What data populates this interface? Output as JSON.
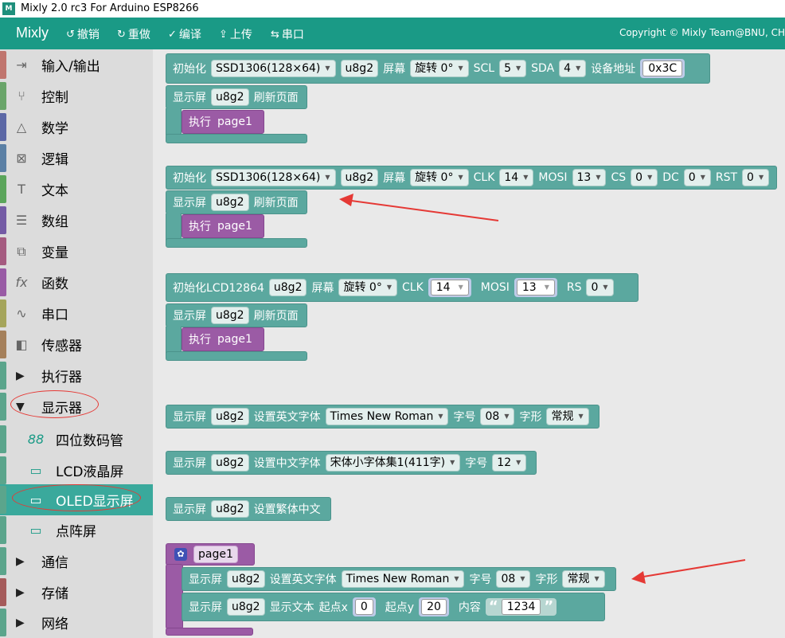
{
  "window": {
    "title": "Mixly 2.0 rc3 For Arduino ESP8266",
    "icon": "mixly-app-icon"
  },
  "toolbar": {
    "brand": "Mixly",
    "undo": "撤销",
    "redo": "重做",
    "compile": "编译",
    "upload": "上传",
    "serial": "串口",
    "copyright": "Copyright © Mixly Team@BNU, CH"
  },
  "sidebar": {
    "items": [
      {
        "label": "输入/输出",
        "icon": "login-icon",
        "color": "#c0756e"
      },
      {
        "label": "控制",
        "icon": "branch-icon",
        "color": "#6aa56a"
      },
      {
        "label": "数学",
        "icon": "compass-icon",
        "color": "#5c68a6"
      },
      {
        "label": "逻辑",
        "icon": "logic-icon",
        "color": "#5b80a5"
      },
      {
        "label": "文本",
        "icon": "text-icon",
        "color": "#5ba55b"
      },
      {
        "label": "数组",
        "icon": "list-icon",
        "color": "#745ba5"
      },
      {
        "label": "变量",
        "icon": "variable-icon",
        "color": "#a55b80"
      },
      {
        "label": "函数",
        "icon": "function-icon",
        "color": "#995ba5"
      },
      {
        "label": "串口",
        "icon": "serial-icon",
        "color": "#a5a55b"
      },
      {
        "label": "传感器",
        "icon": "sensor-icon",
        "color": "#a5805b"
      },
      {
        "label": "执行器",
        "icon": "triangle-right-icon",
        "color": "#5ba58c"
      },
      {
        "label": "显示器",
        "icon": "triangle-down-icon",
        "color": "#5ba58c"
      },
      {
        "label": "四位数码管",
        "icon": "digit-display-icon",
        "color": "#5ba58c"
      },
      {
        "label": "LCD液晶屏",
        "icon": "lcd-icon",
        "color": "#5ba58c"
      },
      {
        "label": "OLED显示屏",
        "icon": "monitor-icon",
        "color": "#5ba58c"
      },
      {
        "label": "点阵屏",
        "icon": "monitor-icon",
        "color": "#5ba58c"
      },
      {
        "label": "通信",
        "icon": "triangle-right-icon",
        "color": "#5ba58c"
      },
      {
        "label": "存储",
        "icon": "triangle-right-icon",
        "color": "#a55b5b"
      },
      {
        "label": "网络",
        "icon": "triangle-right-icon",
        "color": "#5ba58c"
      }
    ]
  },
  "blocks": {
    "init": "初始化",
    "init_lcd": "初始化LCD12864",
    "display": "显示屏",
    "u8g2": "u8g2",
    "screen": "屏幕",
    "rotate": "旋转 0°",
    "refresh": "刷新页面",
    "exec": "执行",
    "page1": "page1",
    "ssd": "SSD1306(128×64)",
    "scl": "SCL",
    "scl_val": "5",
    "sda": "SDA",
    "sda_val": "4",
    "addr": "设备地址",
    "addr_val": "0x3C",
    "clk": "CLK",
    "clk_val": "14",
    "mosi": "MOSI",
    "mosi_val": "13",
    "cs": "CS",
    "cs_val": "0",
    "dc": "DC",
    "dc_val": "0",
    "rst": "RST",
    "rst_val": "0",
    "rs": "RS",
    "rs_val": "0",
    "set_en_font": "设置英文字体",
    "set_cn_font": "设置中文字体",
    "set_trad": "设置繁体中文",
    "font_en": "Times New Roman",
    "font_cn": "宋体小字体集1(411字)",
    "size": "字号",
    "size_08": "08",
    "size_12": "12",
    "style": "字形",
    "style_val": "常规",
    "show_text": "显示文本",
    "start_x": "起点x",
    "x_val": "0",
    "start_y": "起点y",
    "y_val": "20",
    "content": "内容",
    "content_val": "1234"
  },
  "colors": {
    "toolbar": "#1a9a86",
    "block": "#5ba89f",
    "purple_block": "#9b5ba5",
    "annotation": "#e53935"
  }
}
